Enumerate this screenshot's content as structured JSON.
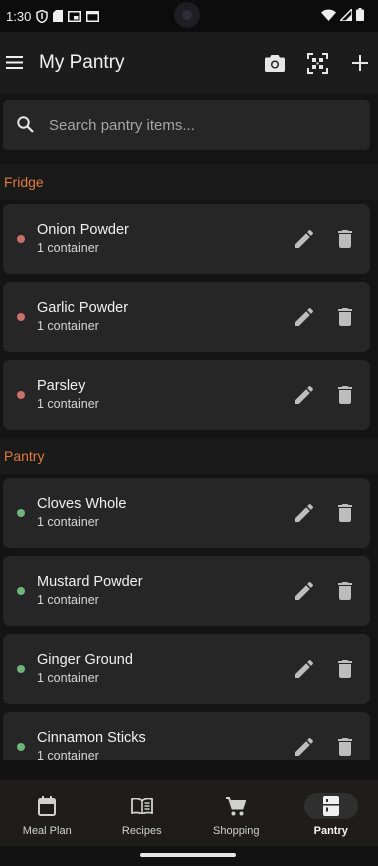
{
  "status_bar": {
    "time": "1:30",
    "left_icons": [
      "shield-icon",
      "sd-card-icon",
      "picture-in-picture-icon",
      "window-icon"
    ],
    "right_icons": [
      "wifi-icon",
      "cell-signal-icon",
      "battery-icon"
    ]
  },
  "app_bar": {
    "title": "My Pantry",
    "actions": [
      "camera-icon",
      "scan-barcode-icon",
      "add-icon"
    ]
  },
  "search": {
    "placeholder": "Search pantry items..."
  },
  "sections": [
    {
      "title": "Fridge",
      "title_color": "#e07a3f",
      "dot_color": "#c9706a",
      "items": [
        {
          "name": "Onion Powder",
          "quantity": "1 container"
        },
        {
          "name": "Garlic Powder",
          "quantity": "1 container"
        },
        {
          "name": "Parsley",
          "quantity": "1 container"
        }
      ]
    },
    {
      "title": "Pantry",
      "title_color": "#e07a3f",
      "dot_color": "#6fb57a",
      "items": [
        {
          "name": "Cloves Whole",
          "quantity": "1 container"
        },
        {
          "name": "Mustard Powder",
          "quantity": "1 container"
        },
        {
          "name": "Ginger Ground",
          "quantity": "1 container"
        },
        {
          "name": "Cinnamon Sticks",
          "quantity": "1 container"
        }
      ]
    }
  ],
  "bottom_nav": {
    "items": [
      {
        "label": "Meal Plan",
        "icon": "calendar-icon"
      },
      {
        "label": "Recipes",
        "icon": "book-icon"
      },
      {
        "label": "Shopping",
        "icon": "cart-icon"
      },
      {
        "label": "Pantry",
        "icon": "pantry-icon",
        "active": true
      }
    ]
  },
  "colors": {
    "accent": "#e07a3f",
    "background": "#121212",
    "card": "#262626",
    "fridge_dot": "#c9706a",
    "pantry_dot": "#6fb57a"
  }
}
